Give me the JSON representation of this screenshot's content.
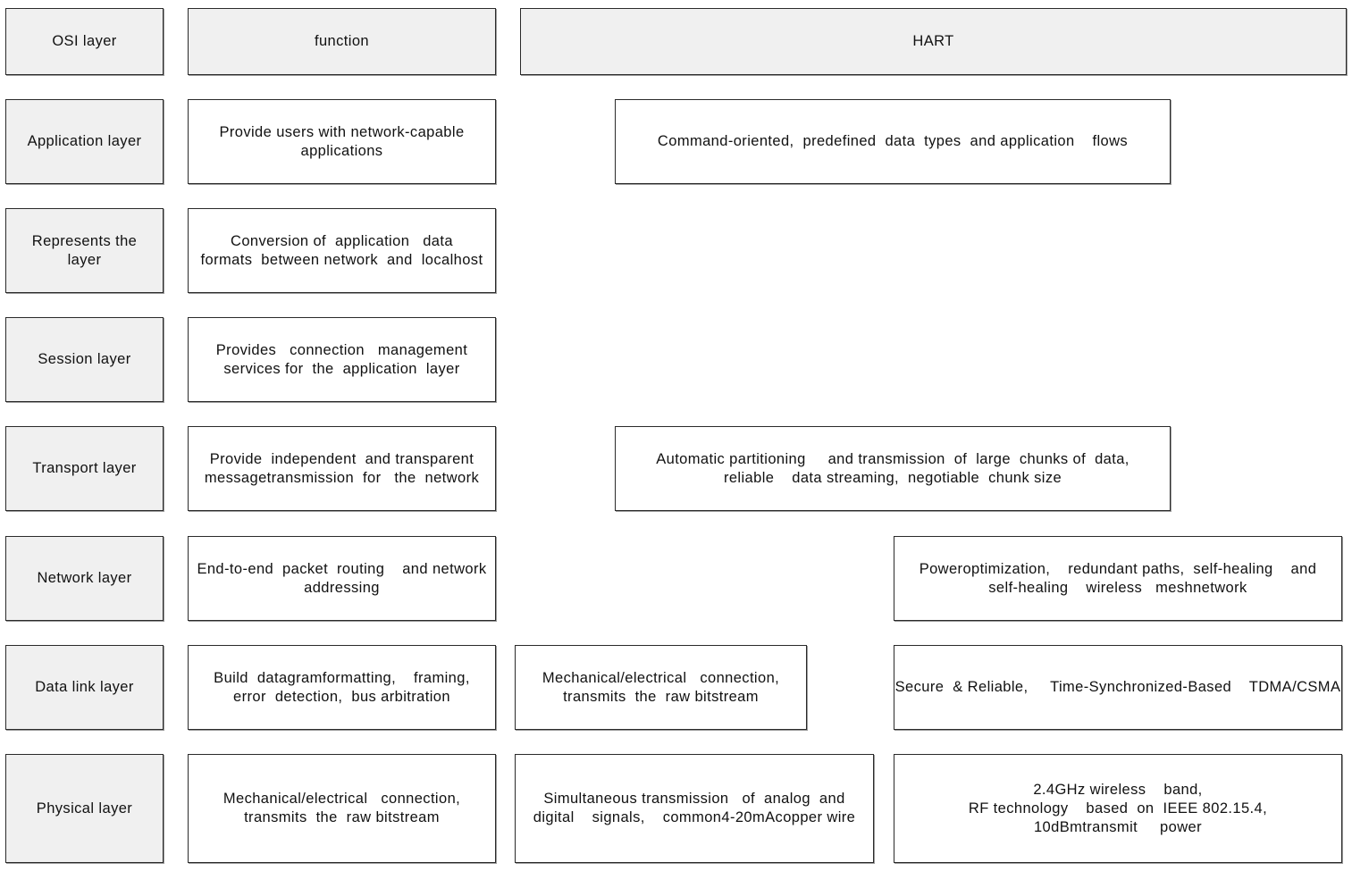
{
  "header": {
    "osi_layer": "OSI layer",
    "function": "function",
    "hart": "HART"
  },
  "rows": [
    {
      "layer": "Application  layer",
      "function": "Provide  users  with  network-capable\napplications",
      "hart": [
        "Command-oriented,  predefined  data  types  and application    flows"
      ]
    },
    {
      "layer": "Represents the\nlayer",
      "function": "Conversion of  application   data\nformats  between network  and  localhost",
      "hart": []
    },
    {
      "layer": "Session layer",
      "function": "Provides   connection   management\nservices for  the  application  layer",
      "hart": []
    },
    {
      "layer": "Transport  layer",
      "function": "Provide  independent  and transparent\nmessagetransmission  for   the  network",
      "hart": [
        "Automatic partitioning     and transmission  of  large  chunks of  data,\nreliable    data streaming,  negotiable  chunk size"
      ]
    },
    {
      "layer": "Network layer",
      "function": "End-to-end  packet  routing    and network\naddressing",
      "hart": [
        "Poweroptimization,    redundant paths,  self-healing    and\nself-healing    wireless   meshnetwork"
      ]
    },
    {
      "layer": "Data link   layer",
      "function": "Build  datagramformatting,    framing,\nerror  detection,  bus arbitration",
      "hart": [
        "Mechanical/electrical   connection,\ntransmits  the  raw bitstream",
        "Secure  & Reliable,     Time-Synchronized-Based    TDMA/CSMA"
      ]
    },
    {
      "layer": "Physical  layer",
      "function": "Mechanical/electrical   connection,\ntransmits  the  raw bitstream",
      "hart": [
        "Simultaneous transmission   of  analog  and\ndigital    signals,    common4-20mAcopper wire",
        "2.4GHz wireless    band,\nRF technology    based  on  IEEE 802.15.4,\n10dBmtransmit     power"
      ]
    }
  ],
  "colors": {
    "header_fill": "#f0f0f0",
    "layer_fill": "#f0f0f0",
    "content_fill": "#ffffff",
    "border": "#2a2a2a"
  }
}
